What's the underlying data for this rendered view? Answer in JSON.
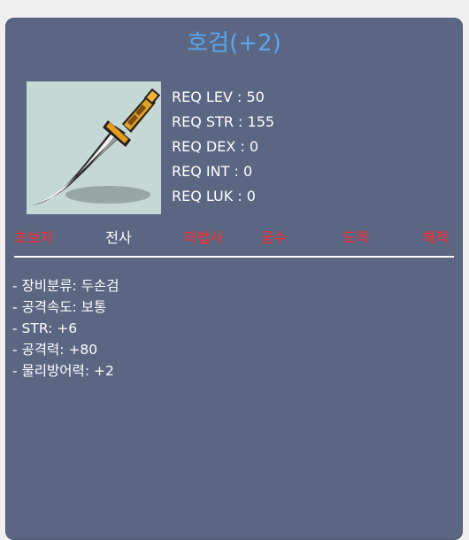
{
  "item": {
    "title": "호검(+2)",
    "icon": "two-handed-sword-icon"
  },
  "requirements": [
    {
      "label": "REQ LEV",
      "value": "50"
    },
    {
      "label": "REQ STR",
      "value": "155"
    },
    {
      "label": "REQ DEX",
      "value": "0"
    },
    {
      "label": "REQ INT",
      "value": "0"
    },
    {
      "label": "REQ LUK",
      "value": "0"
    }
  ],
  "jobs": [
    {
      "name": "초보자",
      "color": "#ff2a2a"
    },
    {
      "name": "전사",
      "color": "#ffffff"
    },
    {
      "name": "마법사",
      "color": "#ff2a2a"
    },
    {
      "name": "궁수",
      "color": "#ff2a2a"
    },
    {
      "name": "도적",
      "color": "#ff2a2a"
    },
    {
      "name": "해적",
      "color": "#ff2a2a"
    }
  ],
  "stats": [
    "- 장비분류: 두손검",
    "- 공격속도: 보통",
    "- STR: +6",
    "- 공격력: +80",
    "- 물리방어력: +2"
  ],
  "colors": {
    "panel": "#5b6683",
    "title": "#5ba6f0",
    "restricted_job": "#ff2a2a",
    "allowed_job": "#ffffff"
  }
}
